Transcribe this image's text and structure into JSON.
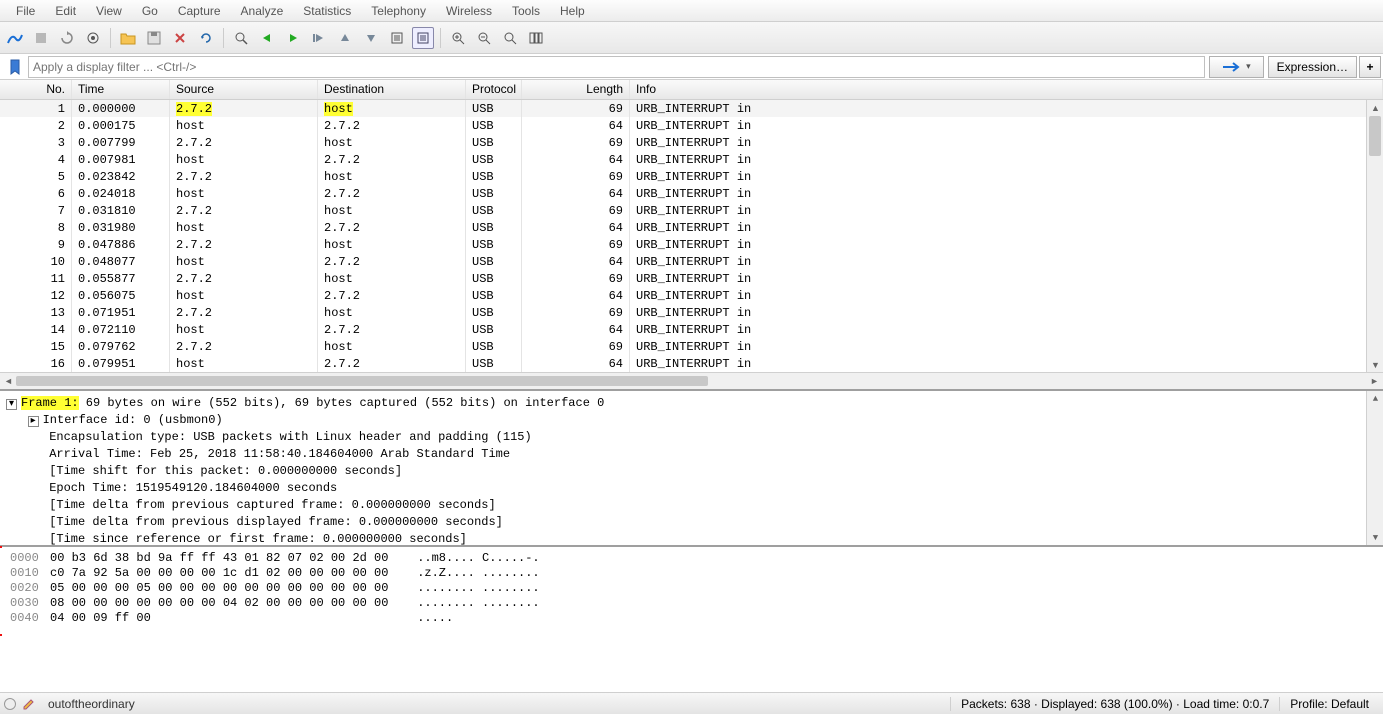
{
  "menu": {
    "items": [
      "File",
      "Edit",
      "View",
      "Go",
      "Capture",
      "Analyze",
      "Statistics",
      "Telephony",
      "Wireless",
      "Tools",
      "Help"
    ]
  },
  "filter": {
    "placeholder": "Apply a display filter ... <Ctrl-/>",
    "expression_label": "Expression…"
  },
  "columns": [
    "No.",
    "Time",
    "Source",
    "Destination",
    "Protocol",
    "Length",
    "Info"
  ],
  "packets": [
    {
      "no": "1",
      "time": "0.000000",
      "src": "2.7.2",
      "dst": "host",
      "proto": "USB",
      "len": "69",
      "info": "URB_INTERRUPT in",
      "hl": true,
      "sel": true
    },
    {
      "no": "2",
      "time": "0.000175",
      "src": "host",
      "dst": "2.7.2",
      "proto": "USB",
      "len": "64",
      "info": "URB_INTERRUPT in"
    },
    {
      "no": "3",
      "time": "0.007799",
      "src": "2.7.2",
      "dst": "host",
      "proto": "USB",
      "len": "69",
      "info": "URB_INTERRUPT in"
    },
    {
      "no": "4",
      "time": "0.007981",
      "src": "host",
      "dst": "2.7.2",
      "proto": "USB",
      "len": "64",
      "info": "URB_INTERRUPT in"
    },
    {
      "no": "5",
      "time": "0.023842",
      "src": "2.7.2",
      "dst": "host",
      "proto": "USB",
      "len": "69",
      "info": "URB_INTERRUPT in"
    },
    {
      "no": "6",
      "time": "0.024018",
      "src": "host",
      "dst": "2.7.2",
      "proto": "USB",
      "len": "64",
      "info": "URB_INTERRUPT in"
    },
    {
      "no": "7",
      "time": "0.031810",
      "src": "2.7.2",
      "dst": "host",
      "proto": "USB",
      "len": "69",
      "info": "URB_INTERRUPT in"
    },
    {
      "no": "8",
      "time": "0.031980",
      "src": "host",
      "dst": "2.7.2",
      "proto": "USB",
      "len": "64",
      "info": "URB_INTERRUPT in"
    },
    {
      "no": "9",
      "time": "0.047886",
      "src": "2.7.2",
      "dst": "host",
      "proto": "USB",
      "len": "69",
      "info": "URB_INTERRUPT in"
    },
    {
      "no": "10",
      "time": "0.048077",
      "src": "host",
      "dst": "2.7.2",
      "proto": "USB",
      "len": "64",
      "info": "URB_INTERRUPT in"
    },
    {
      "no": "11",
      "time": "0.055877",
      "src": "2.7.2",
      "dst": "host",
      "proto": "USB",
      "len": "69",
      "info": "URB_INTERRUPT in"
    },
    {
      "no": "12",
      "time": "0.056075",
      "src": "host",
      "dst": "2.7.2",
      "proto": "USB",
      "len": "64",
      "info": "URB_INTERRUPT in"
    },
    {
      "no": "13",
      "time": "0.071951",
      "src": "2.7.2",
      "dst": "host",
      "proto": "USB",
      "len": "69",
      "info": "URB_INTERRUPT in"
    },
    {
      "no": "14",
      "time": "0.072110",
      "src": "host",
      "dst": "2.7.2",
      "proto": "USB",
      "len": "64",
      "info": "URB_INTERRUPT in"
    },
    {
      "no": "15",
      "time": "0.079762",
      "src": "2.7.2",
      "dst": "host",
      "proto": "USB",
      "len": "69",
      "info": "URB_INTERRUPT in"
    },
    {
      "no": "16",
      "time": "0.079951",
      "src": "host",
      "dst": "2.7.2",
      "proto": "USB",
      "len": "64",
      "info": "URB_INTERRUPT in"
    }
  ],
  "details": {
    "frame_header": "Frame 1:",
    "frame_rest": " 69 bytes on wire (552 bits), 69 bytes captured (552 bits) on interface 0",
    "lines": [
      "Interface id: 0 (usbmon0)",
      "Encapsulation type: USB packets with Linux header and padding (115)",
      "Arrival Time: Feb 25, 2018 11:58:40.184604000 Arab Standard Time",
      "[Time shift for this packet: 0.000000000 seconds]",
      "Epoch Time: 1519549120.184604000 seconds",
      "[Time delta from previous captured frame: 0.000000000 seconds]",
      "[Time delta from previous displayed frame: 0.000000000 seconds]",
      "[Time since reference or first frame: 0.000000000 seconds]"
    ]
  },
  "hex": [
    {
      "off": "0000",
      "b": "00 b3 6d 38 bd 9a ff ff  43 01 82 07 02 00 2d 00",
      "a": "..m8.... C.....-."
    },
    {
      "off": "0010",
      "b": "c0 7a 92 5a 00 00 00 00  1c d1 02 00 00 00 00 00",
      "a": ".z.Z.... ........"
    },
    {
      "off": "0020",
      "b": "05 00 00 00 05 00 00 00  00 00 00 00 00 00 00 00",
      "a": "........ ........"
    },
    {
      "off": "0030",
      "b": "08 00 00 00 00 00 00 00  04 02 00 00 00 00 00 00",
      "a": "........ ........"
    },
    {
      "off": "0040",
      "b": "04 00 09 ff 00",
      "a": "....."
    }
  ],
  "status": {
    "file": "outoftheordinary",
    "packets": "Packets: 638 · Displayed: 638 (100.0%) · Load time: 0:0.7",
    "profile": "Profile: Default"
  }
}
